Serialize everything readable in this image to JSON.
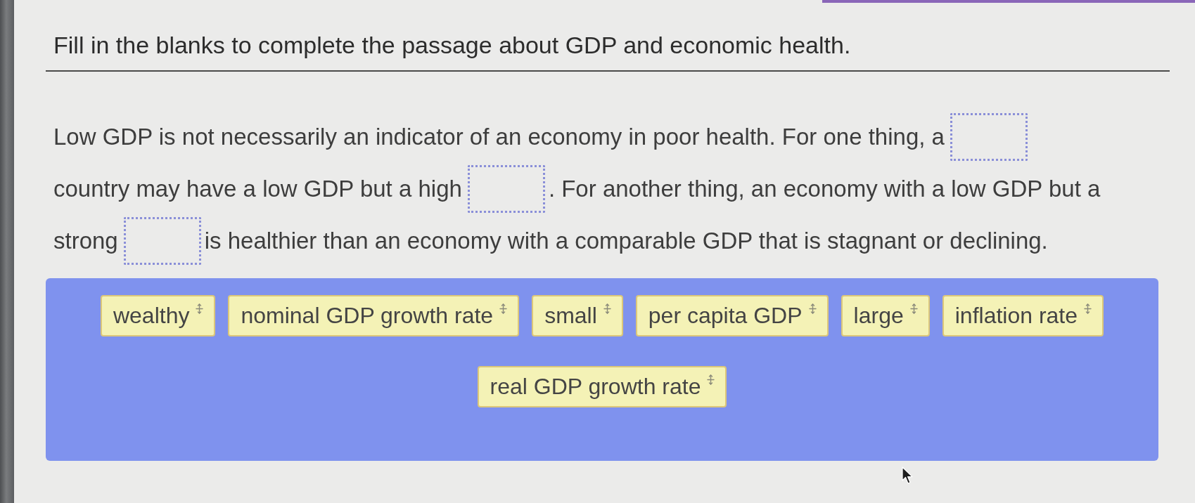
{
  "question": {
    "title": "Fill in the blanks to complete the passage about GDP and economic health."
  },
  "passage_lines": [
    [
      {
        "kind": "text",
        "text": "Low GDP is not necessarily an indicator of an economy in poor health. For one thing, a"
      },
      {
        "kind": "blank"
      }
    ],
    [
      {
        "kind": "text",
        "text": "country may have a low GDP but a high"
      },
      {
        "kind": "blank"
      },
      {
        "kind": "text",
        "text": ". For another thing, an economy with a low GDP but a"
      }
    ],
    [
      {
        "kind": "text",
        "text": "strong"
      },
      {
        "kind": "blank"
      },
      {
        "kind": "text",
        "text": "is healthier than an economy with a comparable GDP that is stagnant or declining."
      }
    ]
  ],
  "word_bank": {
    "tiles": [
      {
        "label": "wealthy"
      },
      {
        "label": "nominal GDP growth rate"
      },
      {
        "label": "small"
      },
      {
        "label": "per capita GDP"
      },
      {
        "label": "large"
      },
      {
        "label": "inflation rate"
      },
      {
        "label": "real GDP growth rate"
      }
    ]
  }
}
